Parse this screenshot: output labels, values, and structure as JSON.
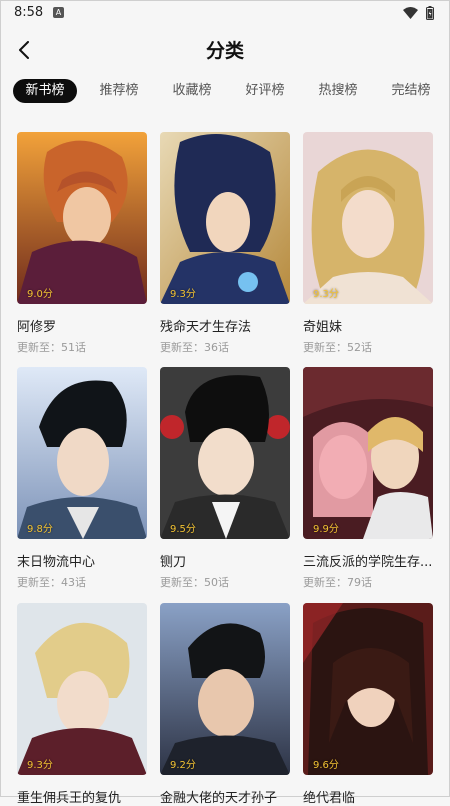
{
  "status_bar": {
    "time": "8:58",
    "app_icon": "A"
  },
  "header": {
    "title": "分类"
  },
  "tabs": [
    {
      "label": "新书榜",
      "active": true
    },
    {
      "label": "推荐榜",
      "active": false
    },
    {
      "label": "收藏榜",
      "active": false
    },
    {
      "label": "好评榜",
      "active": false
    },
    {
      "label": "热搜榜",
      "active": false
    },
    {
      "label": "完结榜",
      "active": false
    }
  ],
  "update_prefix": "更新至：",
  "comics": [
    {
      "title": "阿修罗",
      "score": "9.0分",
      "update": "51话"
    },
    {
      "title": "残命天才生存法",
      "score": "9.3分",
      "update": "36话"
    },
    {
      "title": "奇姐妹",
      "score": "9.3分",
      "update": "52话"
    },
    {
      "title": "末日物流中心",
      "score": "9.8分",
      "update": "43话"
    },
    {
      "title": "铡刀",
      "score": "9.5分",
      "update": "50话"
    },
    {
      "title": "三流反派的学院生存...",
      "score": "9.9分",
      "update": "79话"
    },
    {
      "title": "重生佣兵王的复仇",
      "score": "9.3分",
      "update": ""
    },
    {
      "title": "金融大佬的天才孙子",
      "score": "9.2分",
      "update": ""
    },
    {
      "title": "绝代君临",
      "score": "9.6分",
      "update": ""
    }
  ],
  "colors": {
    "active_tab_bg": "#0d0d0d",
    "score": "#f2c233",
    "subtle_text": "#9a9a9a"
  }
}
